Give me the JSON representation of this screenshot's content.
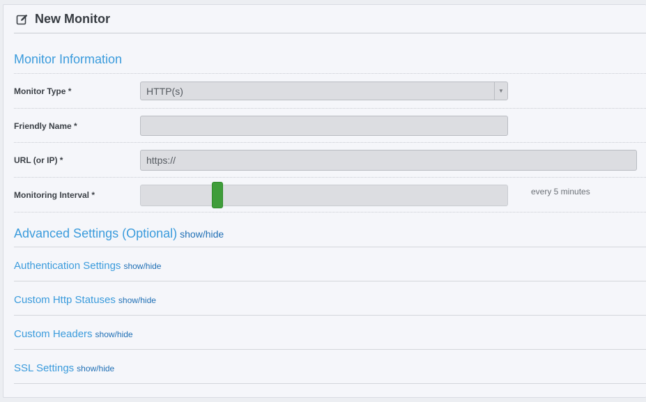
{
  "header": {
    "title": "New Monitor",
    "icon": "edit-icon"
  },
  "monitor_info": {
    "section_title": "Monitor Information",
    "monitor_type": {
      "label": "Monitor Type *",
      "value": "HTTP(s)"
    },
    "friendly_name": {
      "label": "Friendly Name *",
      "value": ""
    },
    "url": {
      "label": "URL (or IP) *",
      "value": "https://"
    },
    "interval": {
      "label": "Monitoring Interval *",
      "text": "every 5 minutes",
      "slider_fraction": 0.2
    }
  },
  "advanced": {
    "title": "Advanced Settings (Optional)",
    "toggle": "show/hide",
    "sections": [
      {
        "title": "Authentication Settings",
        "toggle": "show/hide"
      },
      {
        "title": "Custom Http Statuses",
        "toggle": "show/hide"
      },
      {
        "title": "Custom Headers",
        "toggle": "show/hide"
      },
      {
        "title": "SSL Settings",
        "toggle": "show/hide"
      }
    ]
  },
  "colors": {
    "accent": "#3a9bdc",
    "link": "#1f6fb5",
    "slider": "#3f9d3a"
  }
}
